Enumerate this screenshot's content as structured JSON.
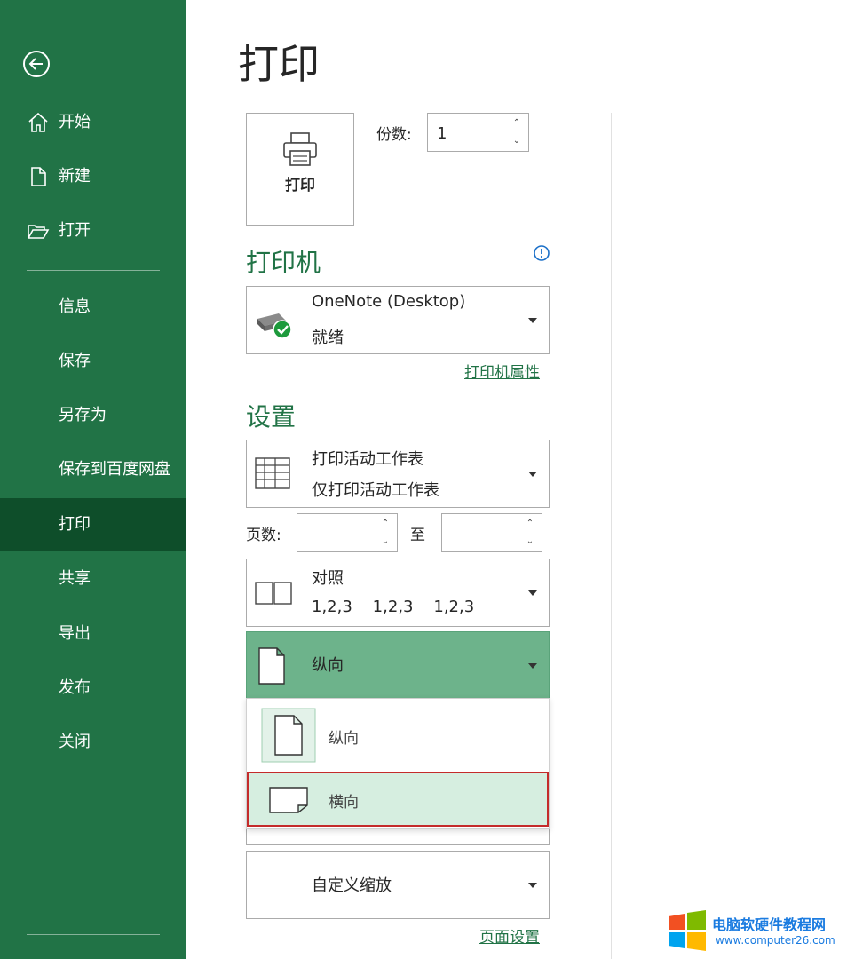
{
  "sidebar": {
    "items": [
      {
        "label": "开始",
        "icon": "home-icon"
      },
      {
        "label": "新建",
        "icon": "new-document-icon"
      },
      {
        "label": "打开",
        "icon": "open-folder-icon"
      },
      {
        "label": "信息"
      },
      {
        "label": "保存"
      },
      {
        "label": "另存为"
      },
      {
        "label": "保存到百度网盘"
      },
      {
        "label": "打印",
        "active": true
      },
      {
        "label": "共享"
      },
      {
        "label": "导出"
      },
      {
        "label": "发布"
      },
      {
        "label": "关闭"
      }
    ]
  },
  "main": {
    "title": "打印",
    "print_button_label": "打印",
    "copies_label": "份数:",
    "copies_value": "1",
    "printer_heading": "打印机",
    "printer": {
      "name": "OneNote (Desktop)",
      "status": "就绪"
    },
    "printer_properties_link": "打印机属性",
    "settings_heading": "设置",
    "print_what": {
      "line1": "打印活动工作表",
      "line2": "仅打印活动工作表"
    },
    "pages_label": "页数:",
    "pages_from": "",
    "to_label": "至",
    "pages_to": "",
    "collation": {
      "line1": "对照",
      "line2": "1,2,3    1,2,3    1,2,3"
    },
    "orientation": {
      "label": "纵向"
    },
    "orientation_options": [
      {
        "label": "纵向"
      },
      {
        "label": "横向"
      }
    ],
    "scaling": {
      "label": "自定义缩放"
    },
    "page_setup_link": "页面设置"
  },
  "watermark": {
    "title": "电脑软硬件教程网",
    "url": "www.computer26.com"
  },
  "colors": {
    "accent": "#217346",
    "active_nav": "#0e4e2a",
    "highlight": "#6db38b",
    "selected_option": "#d6eee0",
    "selection_border": "#c42b2b"
  }
}
